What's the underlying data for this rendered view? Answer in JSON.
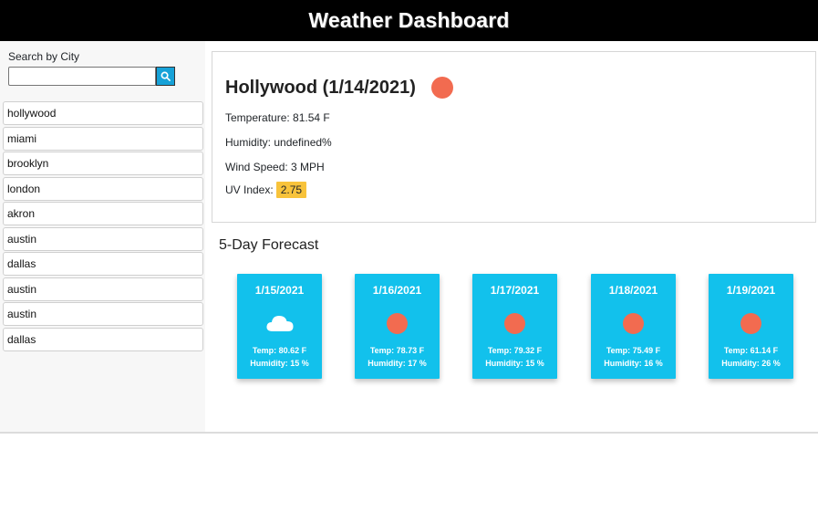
{
  "header": {
    "title": "Weather Dashboard"
  },
  "search": {
    "label": "Search by City",
    "value": "",
    "placeholder": "",
    "button_icon": "search-icon"
  },
  "cities": [
    "hollywood",
    "miami",
    "brooklyn",
    "london",
    "akron",
    "austin",
    "dallas",
    "austin",
    "austin",
    "dallas"
  ],
  "current": {
    "title": "Hollywood (1/14/2021)",
    "icon": "sun-icon",
    "temperature": "Temperature: 81.54 F",
    "humidity": "Humidity: undefined%",
    "wind": "Wind Speed: 3 MPH",
    "uv_label": "UV Index:",
    "uv_value": "2.75"
  },
  "forecast_title": "5-Day Forecast",
  "forecast": [
    {
      "date": "1/15/2021",
      "icon": "cloud-icon",
      "temp": "Temp: 80.62 F",
      "humidity": "Humidity: 15 %"
    },
    {
      "date": "1/16/2021",
      "icon": "sun-icon",
      "temp": "Temp: 78.73 F",
      "humidity": "Humidity: 17 %"
    },
    {
      "date": "1/17/2021",
      "icon": "sun-icon",
      "temp": "Temp: 79.32 F",
      "humidity": "Humidity: 15 %"
    },
    {
      "date": "1/18/2021",
      "icon": "sun-icon",
      "temp": "Temp: 75.49 F",
      "humidity": "Humidity: 16 %"
    },
    {
      "date": "1/19/2021",
      "icon": "sun-icon",
      "temp": "Temp: 61.14 F",
      "humidity": "Humidity: 26 %"
    }
  ],
  "colors": {
    "header_bg": "#000000",
    "card_bg": "#12c1ec",
    "sun": "#f26b50",
    "uv_badge": "#f8c33b",
    "search_button": "#17a2d8"
  }
}
